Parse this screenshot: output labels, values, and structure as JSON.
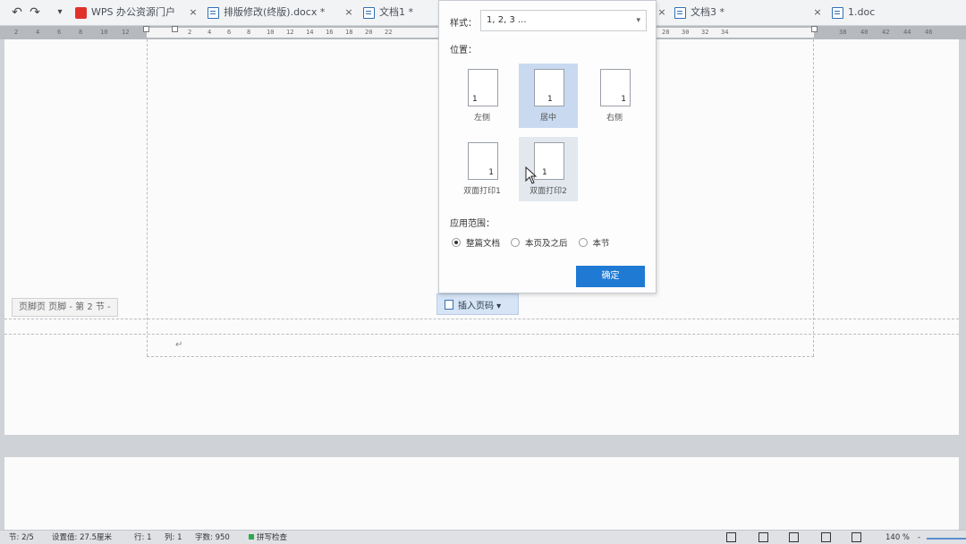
{
  "tabs": [
    {
      "label": "WPS 办公资源门户",
      "icon": "wps-icon"
    },
    {
      "label": "排版修改(终版).docx *",
      "icon": "doc-icon"
    },
    {
      "label": "文档1 *",
      "icon": "doc-icon"
    },
    {
      "label": "文档3 *",
      "icon": "doc-icon"
    },
    {
      "label": "1.doc",
      "icon": "doc-icon"
    }
  ],
  "quick_access": {
    "undo": "↶",
    "redo": "↷",
    "dropdown": "▾"
  },
  "tab_close": "×",
  "ruler_left": [
    "2",
    "4",
    "6",
    "8",
    "10",
    "12"
  ],
  "ruler_main": [
    "2",
    "4",
    "6",
    "8",
    "10",
    "12",
    "14",
    "16",
    "18",
    "20",
    "22"
  ],
  "ruler_right_a": [
    "28",
    "30",
    "32",
    "34"
  ],
  "ruler_right_b": [
    "38",
    "40",
    "42",
    "44",
    "46"
  ],
  "page_number_popup": {
    "style_label": "样式：",
    "style_value": "1, 2, 3 ...",
    "position_label": "位置：",
    "positions": [
      {
        "label": "左侧",
        "num": "1"
      },
      {
        "label": "居中",
        "num": "1"
      },
      {
        "label": "右侧",
        "num": "1"
      },
      {
        "label": "双面打印1",
        "num": "1"
      },
      {
        "label": "双面打印2",
        "num": "1"
      }
    ],
    "apply_label": "应用范围：",
    "apply_options": [
      "整篇文档",
      "本页及之后",
      "本节"
    ],
    "ok_label": "确定"
  },
  "footer_tag": "页脚页 页脚 - 第 2 节 -",
  "insert_page_number": "插入页码 ▾",
  "para_mark": "↵",
  "statusbar": {
    "section": "节: 2/5",
    "setting": "设置值: 27.5厘米",
    "row": "行: 1",
    "col": "列: 1",
    "words": "字数: 950",
    "spell": "拼写检查",
    "zoom": "140 %",
    "zoom_minus": "-"
  }
}
